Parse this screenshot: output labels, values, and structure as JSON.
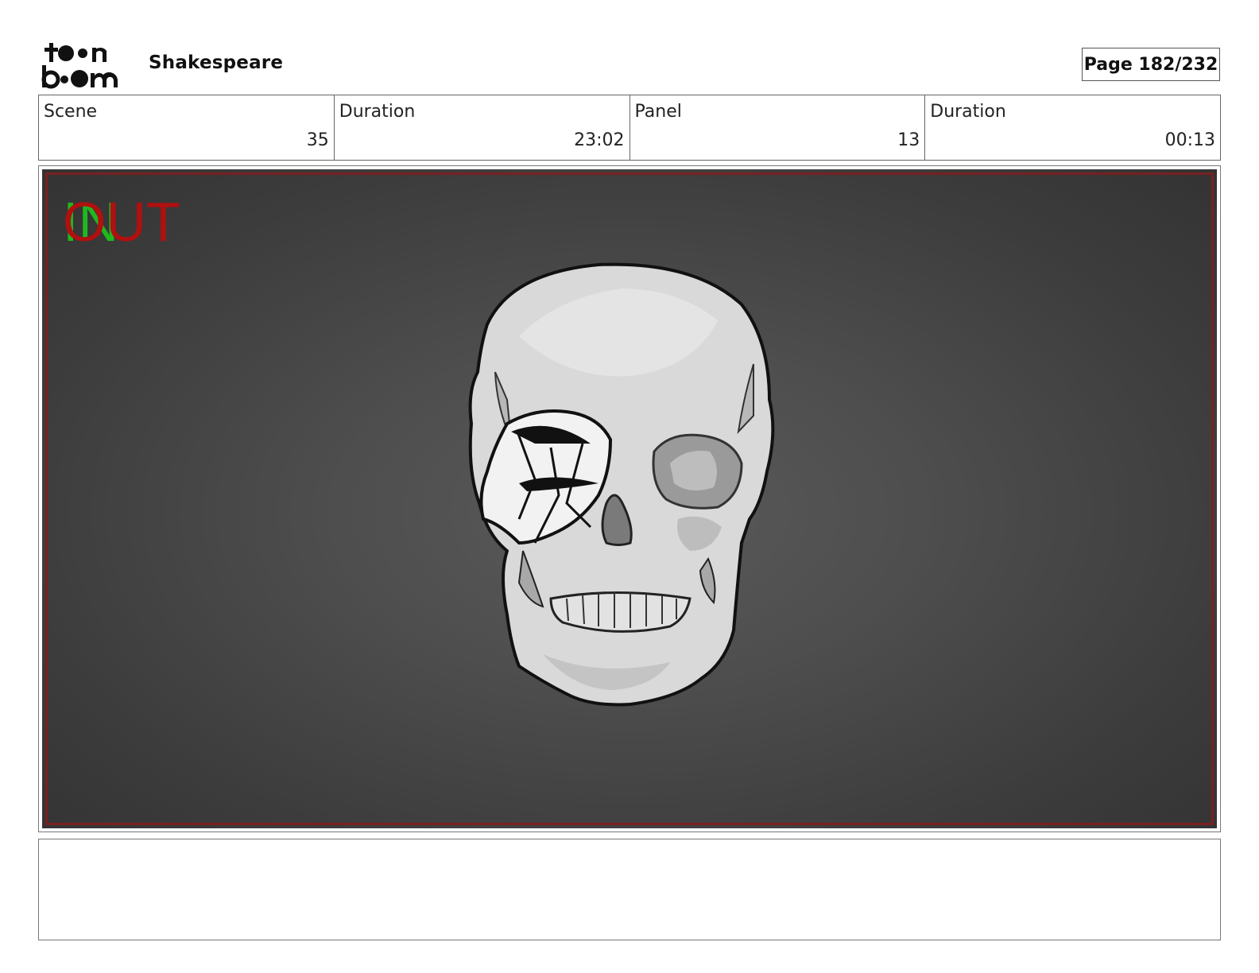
{
  "header": {
    "logo_text": "toon boom",
    "project_title": "Shakespeare",
    "page_label": "Page 182/232"
  },
  "info": [
    {
      "label": "Scene",
      "value": "35"
    },
    {
      "label": "Duration",
      "value": "23:02"
    },
    {
      "label": "Panel",
      "value": "13"
    },
    {
      "label": "Duration",
      "value": "00:13"
    }
  ],
  "panel": {
    "in_marker": "IN",
    "out_marker": "OUT",
    "in_color": "#1fb81f",
    "out_color": "#b01010",
    "safe_frame_color": "#7a2020"
  },
  "notes": {
    "text": ""
  }
}
